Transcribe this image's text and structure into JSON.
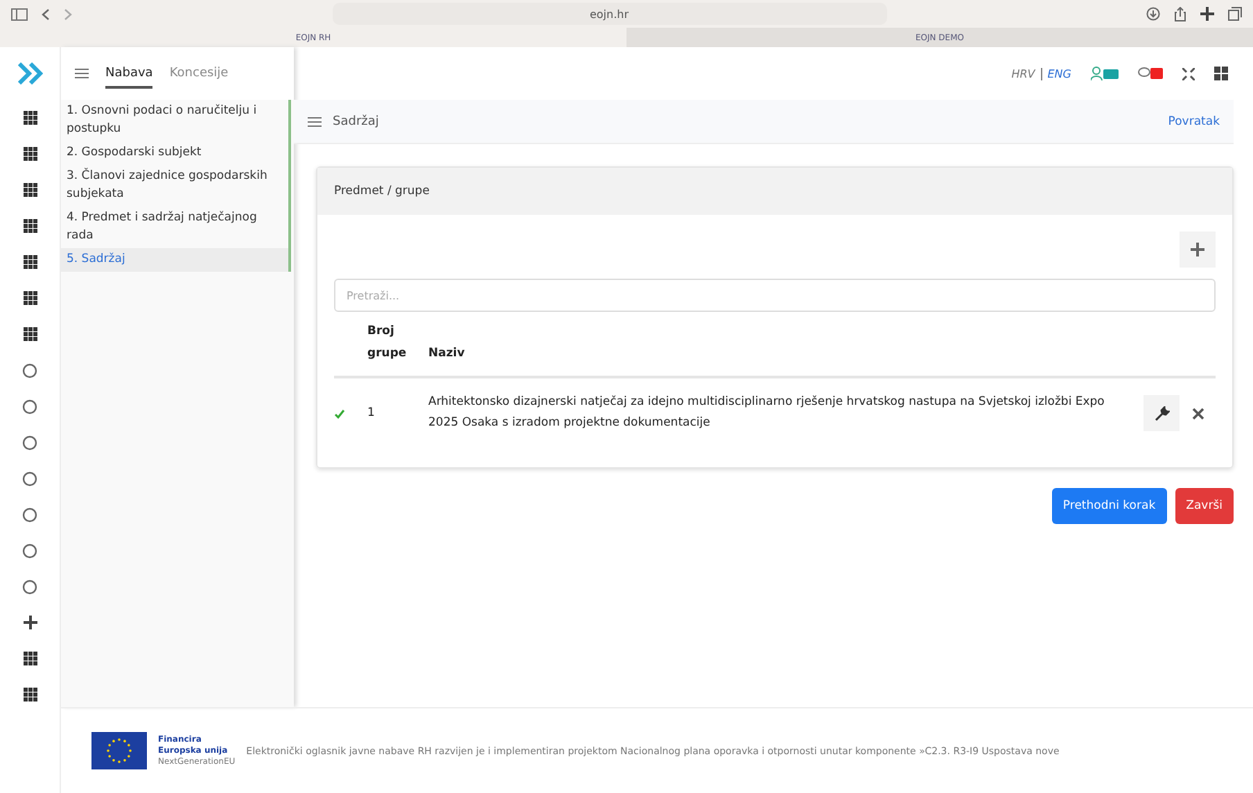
{
  "browser": {
    "url": "eojn.hr",
    "tabs": [
      {
        "label": "EOJN RH",
        "selected": true
      },
      {
        "label": "EOJN DEMO",
        "selected": false
      }
    ]
  },
  "top_tabs": [
    {
      "label": "Nabava",
      "selected": true
    },
    {
      "label": "Koncesije",
      "selected": false
    }
  ],
  "languages": [
    {
      "label": "HRV",
      "selected": false
    },
    {
      "label": "ENG",
      "selected": true
    }
  ],
  "sidebar": {
    "items": [
      {
        "label": "1. Osnovni podaci o naručitelju i postupku",
        "selected": false
      },
      {
        "label": "2. Gospodarski subjekt",
        "selected": false
      },
      {
        "label": "3. Članovi zajednice gospodarskih subjekata",
        "selected": false
      },
      {
        "label": "4. Predmet i sadržaj natječajnog rada",
        "selected": false
      },
      {
        "label": "5. Sadržaj",
        "selected": true
      }
    ]
  },
  "header": {
    "title": "Sadržaj",
    "back_link": "Povratak"
  },
  "card": {
    "title": "Predmet / grupe",
    "search": {
      "placeholder": "Pretraži..."
    },
    "table": {
      "columns": [
        "Broj grupe",
        "Naziv"
      ],
      "rows": [
        {
          "valid": true,
          "number": "1",
          "name": "Arhitektonsko dizajnerski natječaj za idejno multidisciplinarno rješenje hrvatskog nastupa na Svjetskoj izložbi Expo 2025 Osaka s izradom projektne dokumentacije"
        }
      ]
    }
  },
  "buttons": [
    {
      "label": "Prethodni korak",
      "kind": "primary"
    },
    {
      "label": "Završi",
      "kind": "danger"
    }
  ],
  "footer": {
    "line1": "Financira",
    "line2": "Europska unija",
    "line3": "NextGenerationEU",
    "text": "Elektronički oglasnik javne nabave RH razvijen je i implementiran projektom Nacionalnog plana oporavka i otpornosti unutar komponente »C2.3. R3-I9 Uspostava nove"
  }
}
